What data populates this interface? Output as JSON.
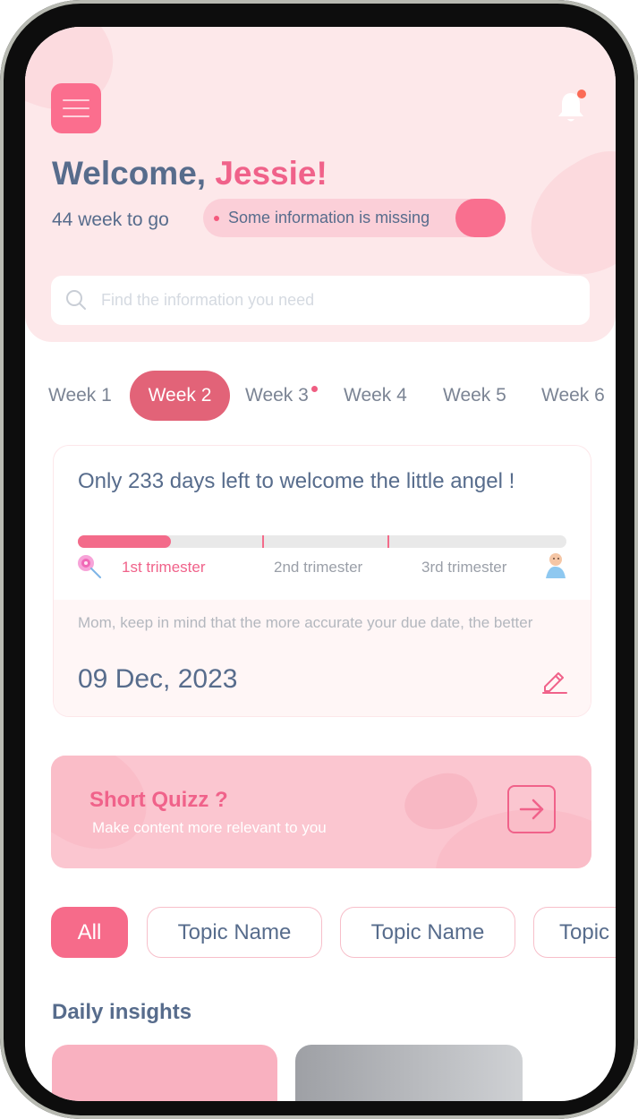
{
  "header": {
    "greeting": "Welcome,",
    "name": "Jessie!",
    "weeks_to_go": "44 week to go",
    "missing_info": "Some information is missing",
    "search_placeholder": "Find the information you need"
  },
  "weeks": {
    "items": [
      "Week 1",
      "Week 2",
      "Week 3",
      "Week 4",
      "Week 5",
      "Week 6"
    ],
    "selected": "Week 2"
  },
  "progress_card": {
    "headline": "Only 233 days left to welcome the little angel !",
    "progress": 0.19,
    "trimesters": [
      "1st trimester",
      "2nd trimester",
      "3rd trimester"
    ],
    "note": "Mom, keep in mind that the more accurate your due date, the better",
    "due_date": "09 Dec, 2023"
  },
  "quiz": {
    "title": "Short Quizz ?",
    "subtitle": "Make content more relevant to you"
  },
  "topics": [
    "All",
    "Topic Name",
    "Topic Name",
    "Topic"
  ],
  "insights": {
    "title": "Daily insights"
  },
  "colors": {
    "accent": "#f0628a",
    "text": "#576c8c",
    "hero_bg": "#fde8ea"
  }
}
